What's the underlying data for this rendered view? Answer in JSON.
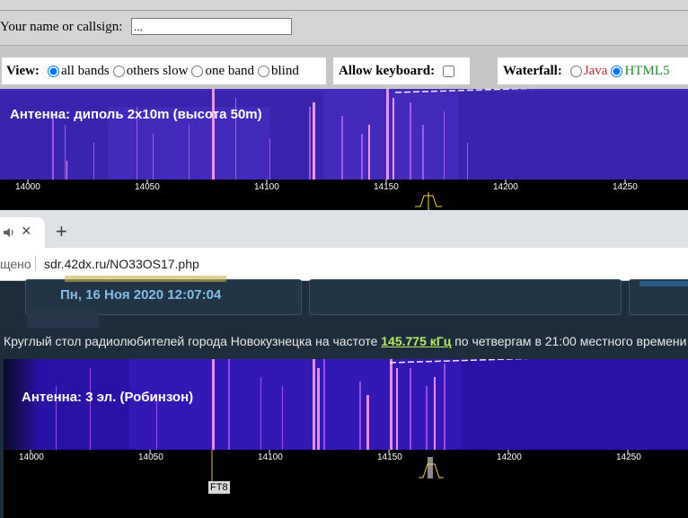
{
  "top_panel": {
    "name_label": "Your name or callsign:",
    "name_value": "...",
    "view_label": "View:",
    "view_options": [
      "all bands",
      "others slow",
      "one band",
      "blind"
    ],
    "view_selected": "all bands",
    "keyboard_label": "Allow keyboard:",
    "waterfall_label": "Waterfall:",
    "waterfall_options": [
      "Java",
      "HTML5"
    ],
    "waterfall_selected": "HTML5"
  },
  "waterfall_top": {
    "antenna": "Антенна: диполь 2x10m (высота 50m)",
    "ticks": [
      "14000",
      "14050",
      "14100",
      "14150",
      "14200",
      "14250"
    ]
  },
  "browser": {
    "close_symbol": "×",
    "new_tab_symbol": "+",
    "security_text": "щено",
    "url": "sdr.42dx.ru/NO33OS17.php"
  },
  "site": {
    "date": "Пн, 16 Ноя 2020 12:07:04",
    "info_prefix": "Круглый стол радиолюбителей города Новокузнецка на частоте ",
    "info_freq": "145.775 кГц",
    "info_suffix": " по четвергам в 21:00 местного времени"
  },
  "waterfall_bottom": {
    "antenna": "Антенна: 3 эл. (Робинзон)",
    "ticks": [
      "14000",
      "14050",
      "14100",
      "14150",
      "14200",
      "14250"
    ],
    "marker": "FT8"
  },
  "colors": {
    "waterfall_bg": "#2a12a6",
    "signal": "#e48cf0",
    "site_bg": "#1e2d3b",
    "link_green": "#b8ea64",
    "date_blue": "#7fbfe8"
  }
}
